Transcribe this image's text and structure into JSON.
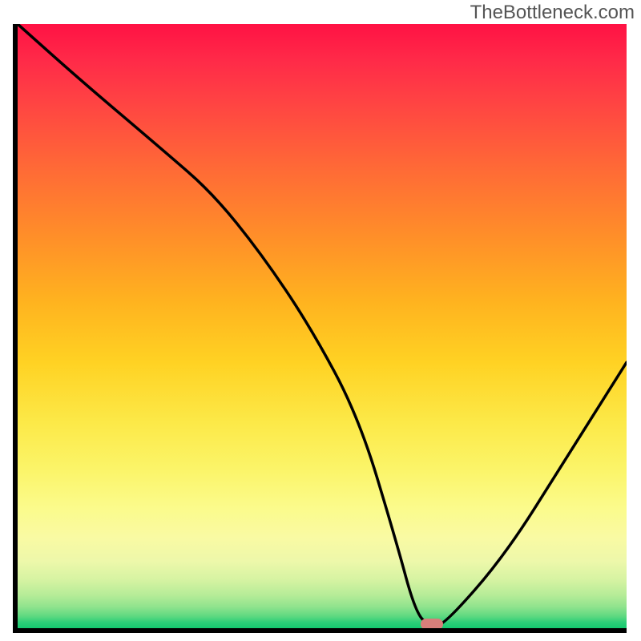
{
  "watermark": "TheBottleneck.com",
  "chart_data": {
    "type": "line",
    "title": "",
    "xlabel": "",
    "ylabel": "",
    "xlim": [
      0,
      100
    ],
    "ylim": [
      0,
      100
    ],
    "series": [
      {
        "name": "curve",
        "x": [
          0,
          10,
          24,
          32,
          40,
          48,
          56,
          62,
          65.5,
          68,
          70,
          80,
          90,
          100
        ],
        "y": [
          100,
          91,
          79,
          72,
          62,
          50,
          35,
          15,
          2,
          0.5,
          0.5,
          12,
          28,
          44
        ]
      }
    ],
    "marker": {
      "x": 68,
      "y": 0.7,
      "color": "#d77f7a"
    },
    "background_gradient": {
      "direction": "vertical",
      "stops": [
        {
          "pos": 0.0,
          "color": "#ff1244"
        },
        {
          "pos": 0.24,
          "color": "#ff6a36"
        },
        {
          "pos": 0.46,
          "color": "#ffb31f"
        },
        {
          "pos": 0.66,
          "color": "#fce948"
        },
        {
          "pos": 0.85,
          "color": "#f9faa3"
        },
        {
          "pos": 0.95,
          "color": "#b6ec98"
        },
        {
          "pos": 1.0,
          "color": "#14c96f"
        }
      ]
    }
  }
}
